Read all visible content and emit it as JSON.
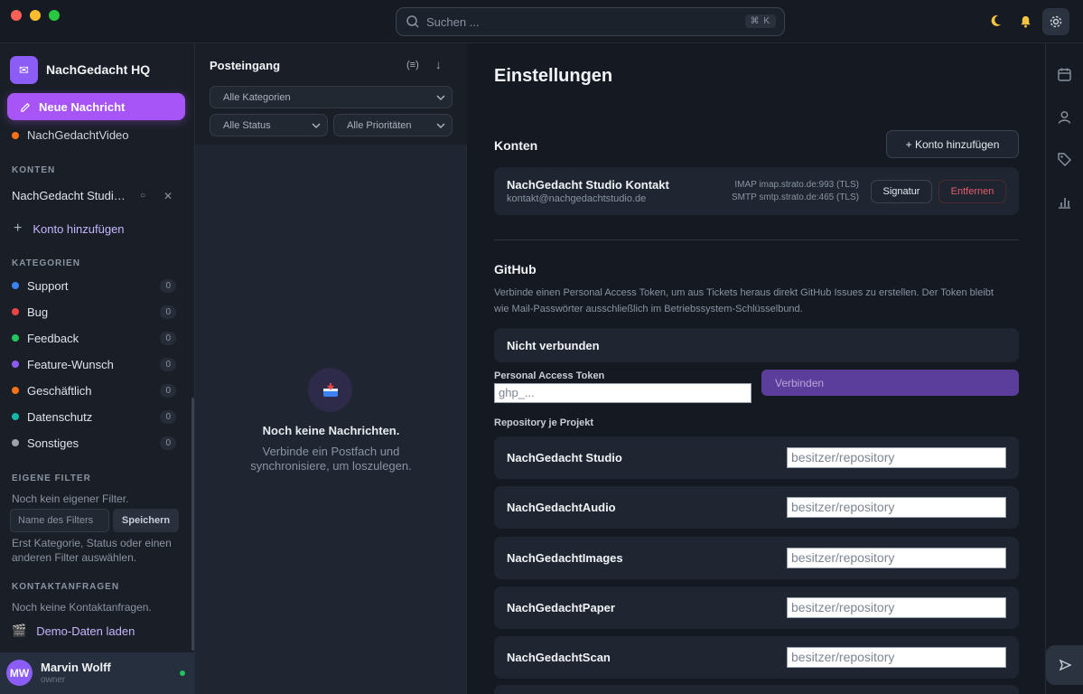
{
  "titlebar": {
    "search_placeholder": "Suchen ...",
    "search_shortcut": "⌘ K"
  },
  "sidebar": {
    "workspace_name": "NachGedacht HQ",
    "compose_label": "Neue Nachricht",
    "cut_item": "NachGedachtVideo",
    "sections": {
      "accounts": "KONTEN",
      "categories": "KATEGORIEN",
      "custom_filters": "EIGENE FILTER",
      "contact_requests": "KONTAKTANFRAGEN"
    },
    "account_name": "NachGedacht Studio Kontakt",
    "add_account": "Konto hinzufügen",
    "categories": [
      {
        "label": "Support",
        "count": "0",
        "color": "#3b82f6"
      },
      {
        "label": "Bug",
        "count": "0",
        "color": "#ef4444"
      },
      {
        "label": "Feedback",
        "count": "0",
        "color": "#22c55e"
      },
      {
        "label": "Feature-Wunsch",
        "count": "0",
        "color": "#8b5cf6"
      },
      {
        "label": "Geschäftlich",
        "count": "0",
        "color": "#f97316"
      },
      {
        "label": "Datenschutz",
        "count": "0",
        "color": "#14b8a6"
      },
      {
        "label": "Sonstiges",
        "count": "0",
        "color": "#9ca3af"
      }
    ],
    "no_filter": "Noch kein eigener Filter.",
    "filter_placeholder": "Name des Filters",
    "filter_save": "Speichern",
    "filter_hint": "Erst Kategorie, Status oder einen anderen Filter auswählen.",
    "no_contact_requests": "Noch keine Kontaktanfragen.",
    "demo_data": "Demo-Daten laden",
    "user": {
      "initials": "MW",
      "name": "Marvin Wolff",
      "role": "owner"
    }
  },
  "inbox": {
    "title": "Posteingang",
    "category_select": "Alle Kategorien",
    "status_select": "Alle Status",
    "priority_select": "Alle Prioritäten",
    "empty_title": "Noch keine Nachrichten.",
    "empty_sub": "Verbinde ein Postfach und synchronisiere, um loszulegen."
  },
  "settings": {
    "title": "Einstellungen",
    "accounts_heading": "Konten",
    "add_account_button": "+ Konto hinzufügen",
    "account": {
      "name": "NachGedacht Studio Kontakt",
      "email": "kontakt@nachgedachtstudio.de",
      "imap": "IMAP imap.strato.de:993 (TLS)",
      "smtp": "SMTP smtp.strato.de:465 (TLS)",
      "signature_button": "Signatur",
      "remove_button": "Entfernen"
    },
    "github": {
      "heading": "GitHub",
      "description": "Verbinde einen Personal Access Token, um aus Tickets heraus direkt GitHub Issues zu erstellen. Der Token bleibt wie Mail-Passwörter ausschließlich im Betriebssystem-Schlüsselbund.",
      "status": "Nicht verbunden",
      "token_label": "Personal Access Token",
      "token_placeholder": "ghp_...",
      "connect_button": "Verbinden",
      "repo_heading": "Repository je Projekt",
      "repo_placeholder": "besitzer/repository",
      "projects": [
        "NachGedacht Studio",
        "NachGedachtAudio",
        "NachGedachtImages",
        "NachGedachtPaper",
        "NachGedachtScan"
      ]
    }
  },
  "colors": {
    "accent": "#a855f7",
    "danger": "#e35d6a",
    "online": "#22c55e"
  }
}
